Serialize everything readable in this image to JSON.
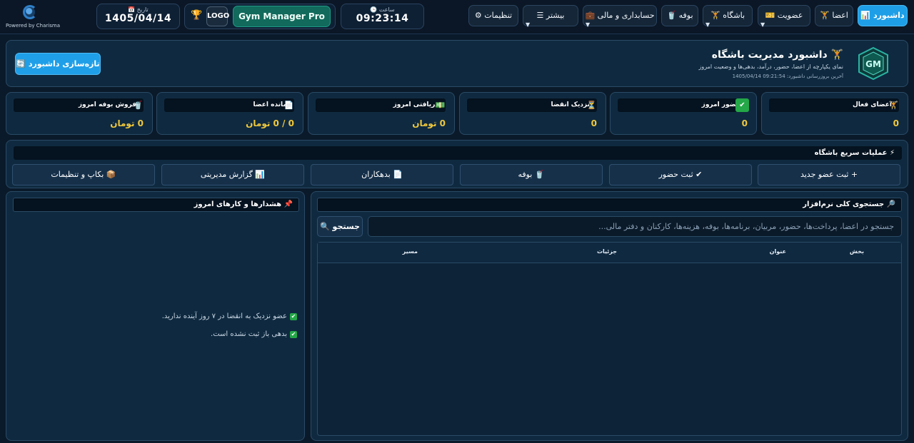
{
  "brand": {
    "powered_by": "Powered by Charisma",
    "logo_icon": "charisma-logo-icon"
  },
  "date": {
    "caption": "📅 تاریخ",
    "value": "1405/04/14"
  },
  "time": {
    "caption": "🕒 ساعت",
    "value": "09:23:14"
  },
  "logo_group": {
    "trophy_icon": "trophy-icon",
    "logo_label": "LOGO",
    "app_name": "Gym Manager Pro"
  },
  "nav": {
    "dashboard": "📊 داشبورد",
    "members": "🏋 اعضا",
    "membership": "🎫 عضویت",
    "club": "🏋 باشگاه",
    "buffet": "🥤 بوفه",
    "accounting": "💼 حسابداری و مالی",
    "more": "☰ بیشتر",
    "settings": "⚙ تنظیمات"
  },
  "header": {
    "emblem_icon": "gym-emblem-icon",
    "title": "🏋 داشبورد مدیریت باشگاه",
    "subtitle": "نمای یکپارچه از اعضا، حضور، درآمد، بدهی‌ها و وضعیت امروز",
    "updated_label": "آخرین بروزرسانی داشبورد:",
    "updated_value": "1405/04/14 09:21:54",
    "refresh_label": "🔄 تازه‌سازی داشبورد"
  },
  "stats": [
    {
      "label": "اعضای فعال",
      "icon": "🏋",
      "value": "0"
    },
    {
      "label": "حضور امروز",
      "icon": "✔",
      "value": "0"
    },
    {
      "label": "نزدیک انقضا",
      "icon": "⏳",
      "value": "0"
    },
    {
      "label": "دریافتی امروز",
      "icon": "💵",
      "value": "0 تومان"
    },
    {
      "label": "مانده اعضا",
      "icon": "📄",
      "value": "0 / 0 تومان"
    },
    {
      "label": "فروش بوفه امروز",
      "icon": "🥤",
      "value": "0 تومان"
    }
  ],
  "quick": {
    "title": "⚡ عملیات سریع باشگاه",
    "buttons": [
      "+ ثبت عضو جدید",
      "✔ ثبت حضور",
      "🥤 بوفه",
      "📄 بدهکاران",
      "📊 گزارش مدیریتی",
      "📦 بکاپ و تنظیمات"
    ]
  },
  "alerts": {
    "title": "📌 هشدارها و کارهای امروز",
    "items": [
      "عضو نزدیک به انقضا در ۷ روز آینده ندارید.",
      "بدهی باز ثبت نشده است."
    ]
  },
  "search": {
    "title": "🔎 جستجوی کلی نرم‌افزار",
    "button": "🔍 جستجو",
    "placeholder": "جستجو در اعضا، پرداخت‌ها، حضور، مربیان، برنامه‌ها، بوفه، هزینه‌ها، کارکنان و دفتر مالی...",
    "columns": [
      "بخش",
      "عنوان",
      "جزئیات",
      "مسیر"
    ]
  }
}
